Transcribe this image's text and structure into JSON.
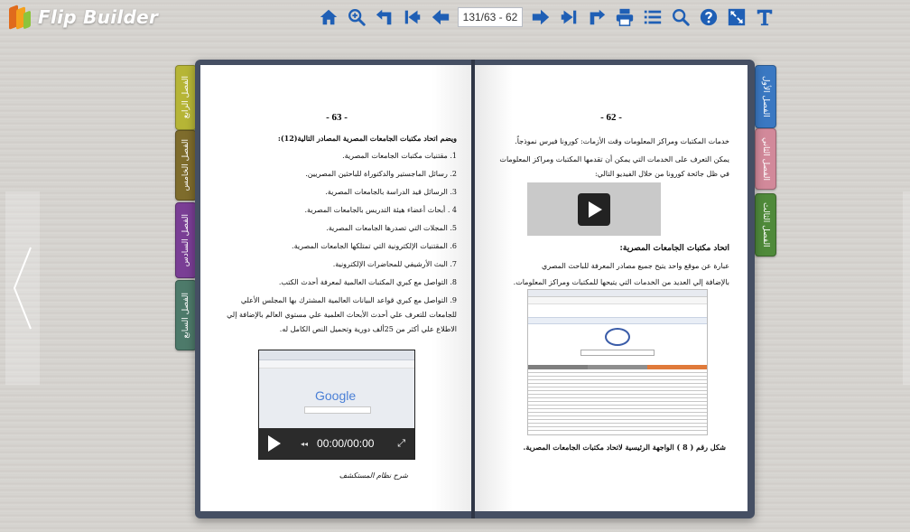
{
  "app": {
    "brand": "Flip Builder",
    "page_indicator": "131/63 - 62"
  },
  "colors": {
    "toolbar_icon": "#1f5fb5",
    "book_frame": "#454f63"
  },
  "toolbar": {
    "icons": [
      "home-icon",
      "zoom-in-icon",
      "back-icon",
      "first-page-icon",
      "previous-page-icon",
      "next-page-icon",
      "last-page-icon",
      "forward-icon",
      "print-icon",
      "table-of-contents-icon",
      "search-icon",
      "help-icon",
      "fullscreen-icon",
      "text-icon"
    ]
  },
  "left_tabs": [
    "الفصل الرابع",
    "الفصل الخامس",
    "الفصل السادس",
    "الفصل السابع"
  ],
  "right_tabs": [
    "الفصل الأول",
    "الفصل الثاني",
    "الفصل الثالث"
  ],
  "left_page": {
    "number": "- 63 -",
    "intro": "ويضم اتحاد مكتبات الجامعات المصرية المصادر التالية(12):",
    "items": [
      "1. مقتنيات مكتبات الجامعات المصرية.",
      "2. رسائل الماجستير والدكتوراة للباحثين المصريين.",
      "3. الرسائل قيد الدراسة بالجامعات المصرية.",
      "4 . أبحاث أعضاء هيئة التدريس بالجامعات المصرية.",
      "5. المجلات التي تصدرها الجامعات المصرية.",
      "6. المقتنيات الإلكترونية التي تمتلكها الجامعات المصرية.",
      "7. البث الأرشيفي للمحاضرات الإلكترونية.",
      "8. التواصل مع كبري المكتبات العالمية لمعرفة أحدث الكتب.",
      "9. التواصل مع كبري قواعد البيانات العالمية المشترك بها المجلس الأعلي"
    ],
    "item9_cont": [
      "للجامعات للتعرف علي أحدث الأبحاث العلمية علي مستوي العالم بالإضافة إلي",
      "الاطلاع علي أكثر من 25ألف دورية وتحميل النص الكامل له."
    ],
    "video_logo": "Google",
    "video_time": "00:00/00:00",
    "caption": "شرح نظام المستكشف"
  },
  "right_page": {
    "number": "- 62 -",
    "lines": [
      "خدمات المكتبات ومراكز المعلومات وقت الأزمات: كورونا فيرس نموذجاً.",
      "يمكن التعرف على الخدمات التي يمكن أن تقدمها المكتبات ومراكز المعلومات",
      "في ظل جائحة كورونا من خلال الفيديو التالي:"
    ],
    "heading": "اتحاد مكتبات الجامعات المصرية:",
    "para": [
      "عبارة عن موقع واحد يتيح جميع مصادر المعرفة للباحث المصري",
      "بالإضافة إلي العديد من الخدمات التي يتيحها للمكتبات ومراكز المعلومات."
    ],
    "figure_caption": "شكل رقم ( 8 ) الواجهة الرئيسية لاتحاد مكتبات الجامعات المصرية."
  }
}
